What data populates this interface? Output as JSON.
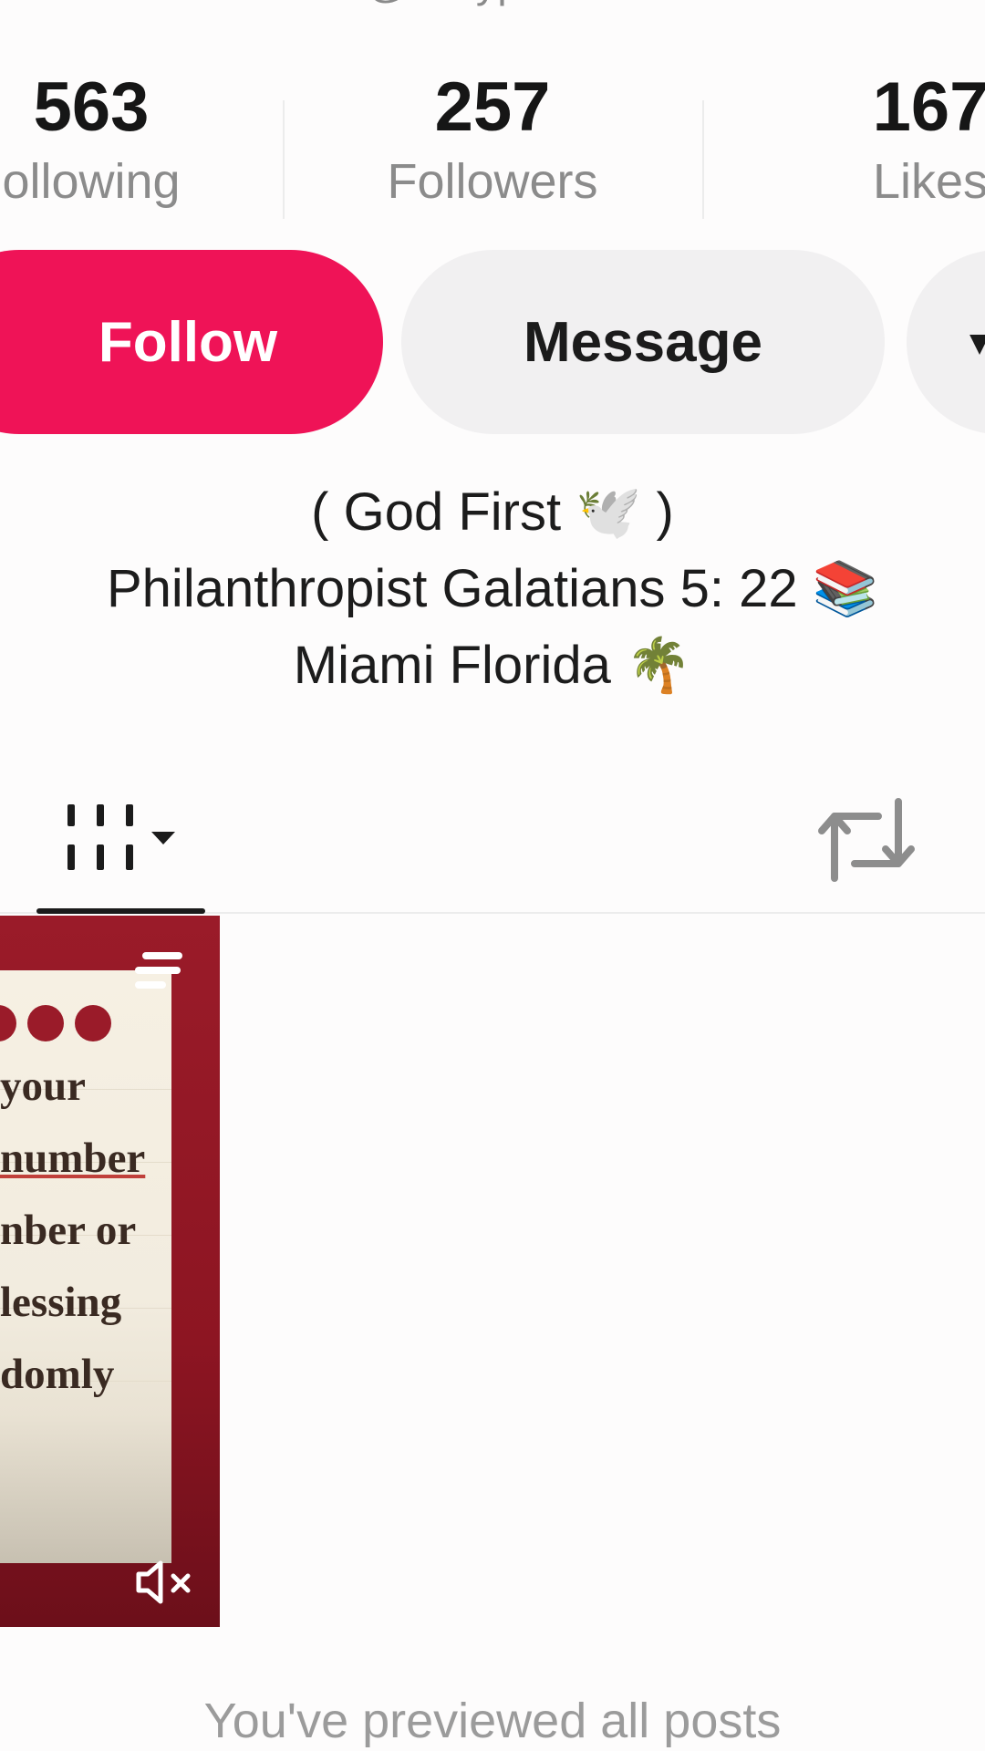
{
  "profile": {
    "handle": "@dollyparton"
  },
  "stats": {
    "following": {
      "count": "563",
      "label": "ollowing"
    },
    "followers": {
      "count": "257",
      "label": "Followers"
    },
    "likes": {
      "count": "167",
      "label": "Likes"
    }
  },
  "actions": {
    "follow_label": "Follow",
    "message_label": "Message",
    "more_label": "▾"
  },
  "bio": {
    "line1": "( God First 🕊️ )",
    "line2": "Philanthropist Galatians 5: 22 📚",
    "line3": "Miami Florida 🌴"
  },
  "tabs": {
    "videos_icon": "grid-dropdown-icon",
    "reposts_icon": "repost-icon"
  },
  "post": {
    "text_lines": [
      "your",
      "number",
      "nber or",
      "lessing",
      "domly"
    ]
  },
  "footer": {
    "text": "You've previewed all posts"
  },
  "colors": {
    "accent": "#ef1357",
    "secondary_button": "#f1f0f1",
    "thumb_bg": "#9a1b29"
  }
}
